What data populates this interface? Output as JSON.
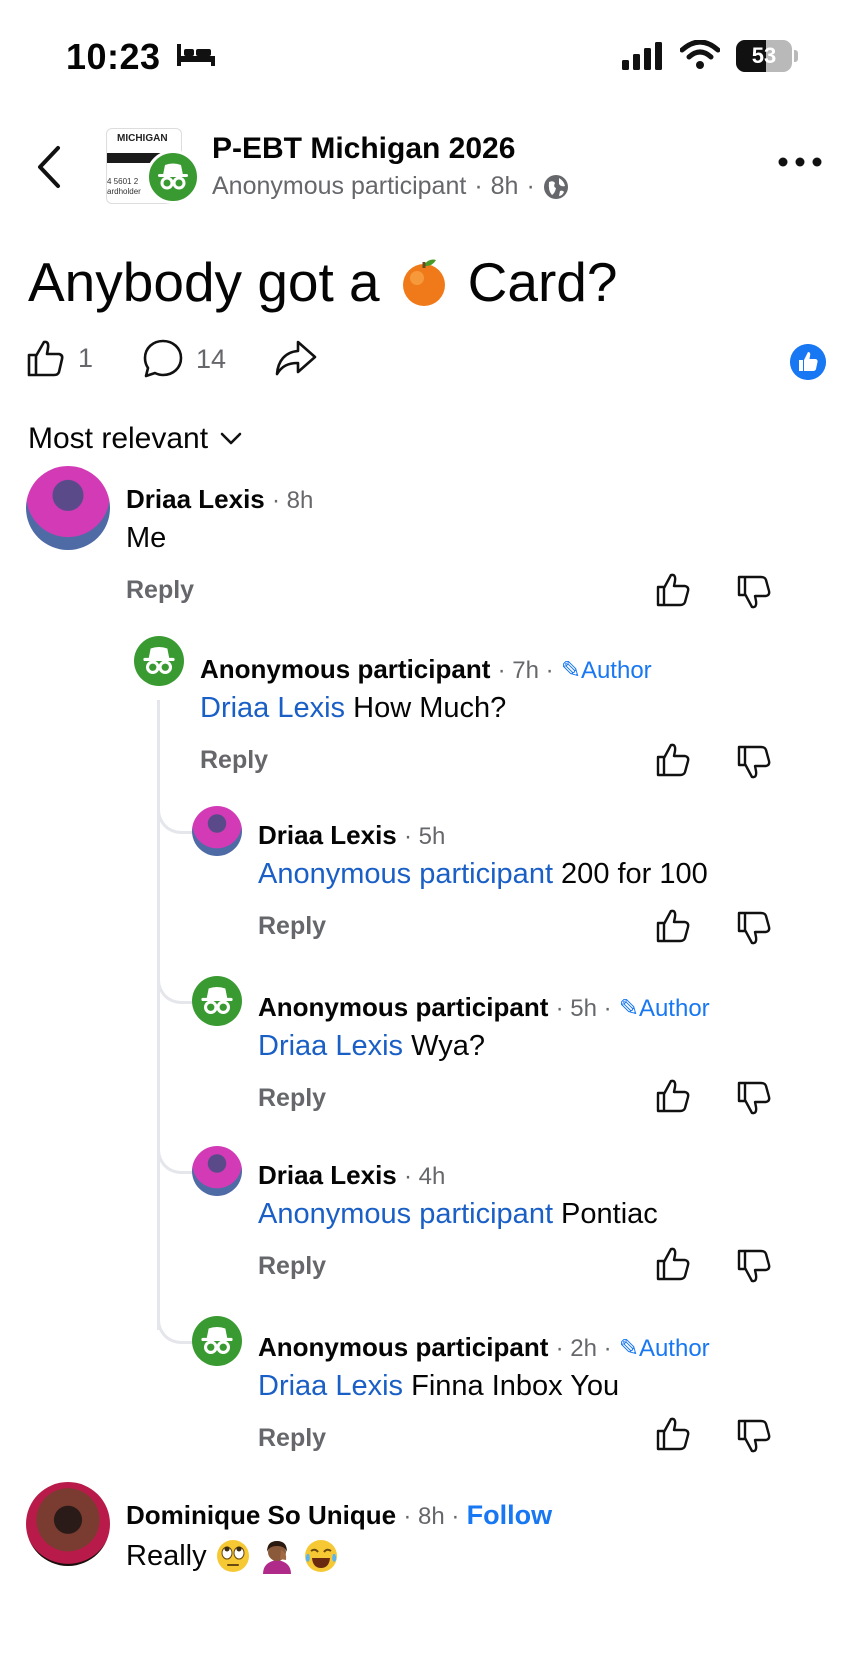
{
  "status_bar": {
    "time": "10:23",
    "battery": "53"
  },
  "header": {
    "group_name": "P-EBT Michigan 2026",
    "author": "Anonymous participant",
    "age": "8h",
    "card_text_a": "MICHIGAN",
    "card_text_b": "4 5601 2",
    "card_text_c": "ardholder"
  },
  "post": {
    "title_before": "Anybody got a",
    "title_after": "Card?",
    "likes": "1",
    "comments": "14"
  },
  "sort": {
    "label": "Most relevant"
  },
  "comments": [
    {
      "name": "Driaa Lexis",
      "time": "· 8h",
      "text": "Me",
      "reply": "Reply"
    },
    {
      "name": "Anonymous participant",
      "time": "· 7h ·",
      "author": "Author",
      "mention": "Driaa Lexis",
      "text": " How Much?",
      "reply": "Reply"
    },
    {
      "name": "Driaa Lexis",
      "time": "· 5h",
      "mention": "Anonymous participant",
      "text": " 200 for 100",
      "reply": "Reply"
    },
    {
      "name": "Anonymous participant",
      "time": "· 5h ·",
      "author": "Author",
      "mention": "Driaa Lexis",
      "text": " Wya?",
      "reply": "Reply"
    },
    {
      "name": "Driaa Lexis",
      "time": "· 4h",
      "mention": "Anonymous participant",
      "text": " Pontiac",
      "reply": "Reply"
    },
    {
      "name": "Anonymous participant",
      "time": "· 2h ·",
      "author": "Author",
      "mention": "Driaa Lexis",
      "text": " Finna Inbox You",
      "reply": "Reply"
    },
    {
      "name": "Dominique So Unique",
      "time": "· 8h ·",
      "follow": "Follow",
      "text": "Really"
    }
  ],
  "colors": {
    "accent": "#1877f2",
    "anon_green": "#3a9a32",
    "muted": "#65676b"
  }
}
